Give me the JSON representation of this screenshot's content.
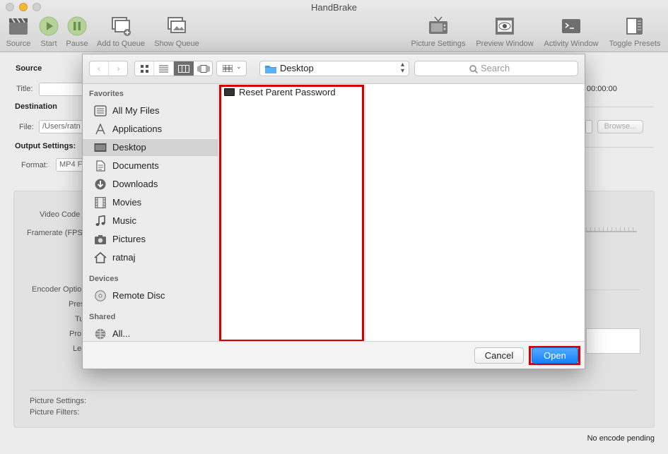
{
  "window": {
    "title": "HandBrake"
  },
  "toolbar": {
    "source": "Source",
    "start": "Start",
    "pause": "Pause",
    "add_to_queue": "Add to Queue",
    "show_queue": "Show Queue",
    "picture_settings": "Picture Settings",
    "preview_window": "Preview Window",
    "activity_window": "Activity Window",
    "toggle_presets": "Toggle Presets"
  },
  "main": {
    "source_header": "Source",
    "title_label": "Title:",
    "duration": "00:00:00",
    "destination_header": "Destination",
    "file_label": "File:",
    "file_value": "/Users/ratn",
    "browse": "Browse...",
    "output_header": "Output Settings:",
    "format_label": "Format:",
    "format_value": "MP4 F",
    "video_codec_label": "Video Code",
    "framerate_label": "Framerate (FPS",
    "encoder_options_label": "Encoder Optio",
    "preset_label": "Pres",
    "tune_label": "Tu",
    "profile_label": "Pro",
    "level_label": "Le",
    "picture_settings_label": "Picture Settings:",
    "picture_filters_label": "Picture Filters:",
    "status": "No encode pending"
  },
  "dialog": {
    "location": "Desktop",
    "search_placeholder": "Search",
    "sidebar": {
      "favorites_header": "Favorites",
      "favorites": [
        "All My Files",
        "Applications",
        "Desktop",
        "Documents",
        "Downloads",
        "Movies",
        "Music",
        "Pictures",
        "ratnaj"
      ],
      "devices_header": "Devices",
      "devices": [
        "Remote Disc"
      ],
      "shared_header": "Shared",
      "shared": [
        "All..."
      ]
    },
    "files": [
      "Reset Parent Password"
    ],
    "cancel": "Cancel",
    "open": "Open"
  },
  "colors": {
    "highlight": "#d40000",
    "accent": "#1a82fb",
    "selected_row": "#d3d3d3"
  }
}
